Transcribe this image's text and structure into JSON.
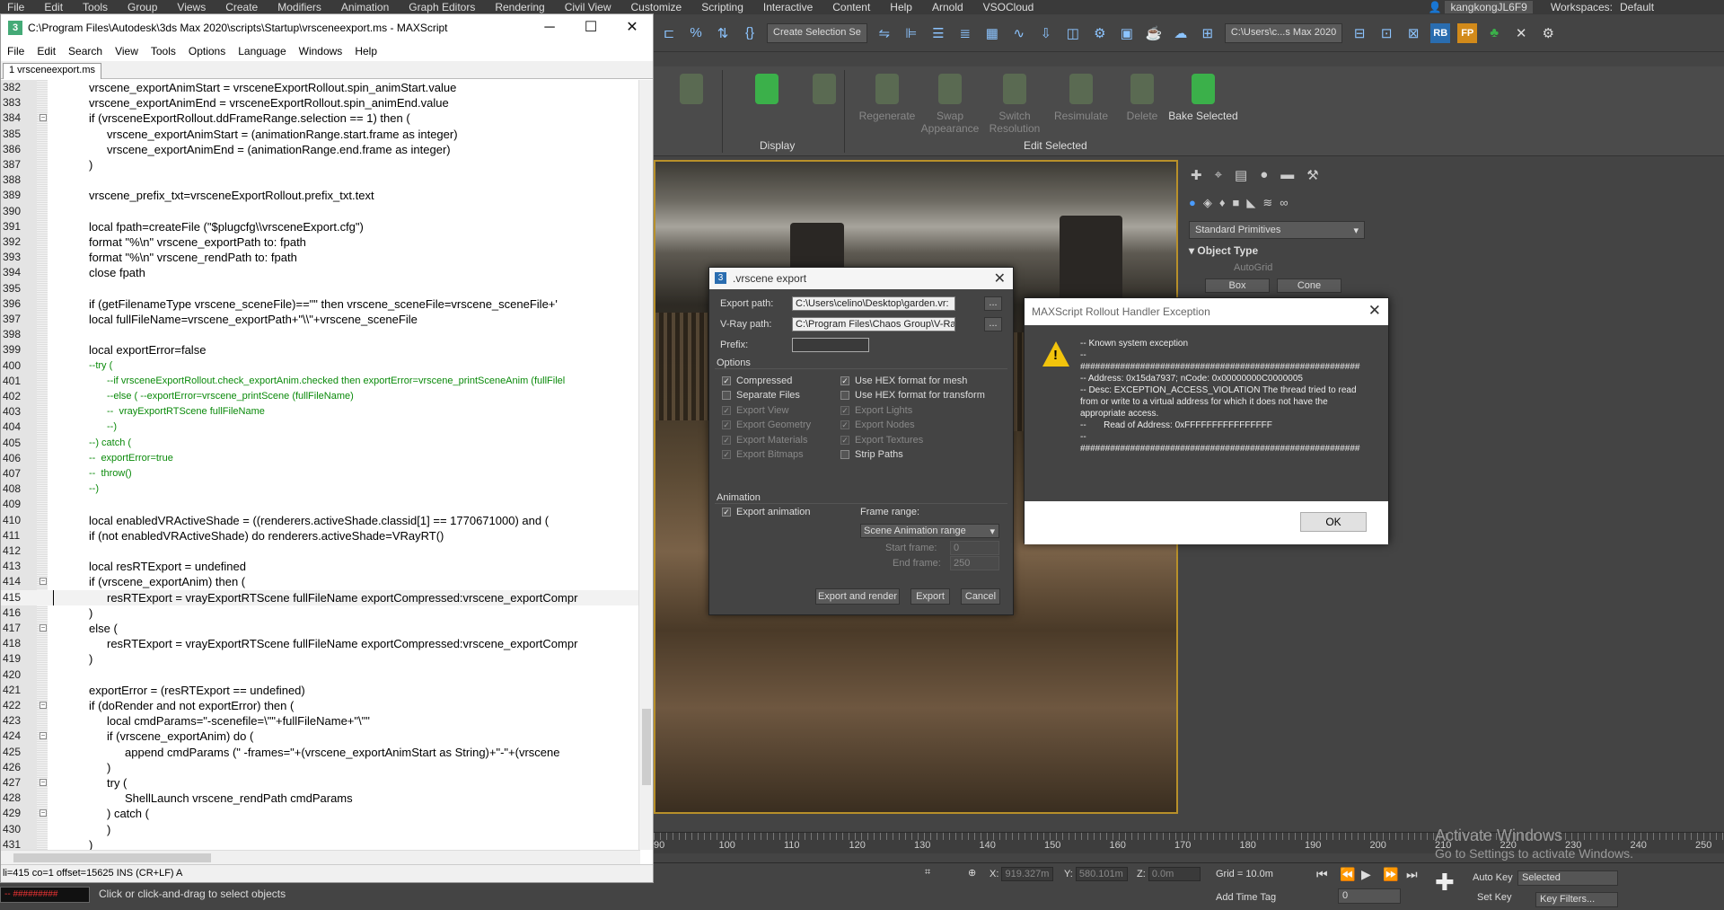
{
  "max": {
    "menu": [
      "File",
      "Edit",
      "Tools",
      "Group",
      "Views",
      "Create",
      "Modifiers",
      "Animation",
      "Graph Editors",
      "Rendering",
      "Civil View",
      "Customize",
      "Scripting",
      "Interactive",
      "Content",
      "Help",
      "Arnold",
      "VSOCloud"
    ],
    "user": "kangkongJL6F9",
    "workspaces_label": "Workspaces:",
    "workspace_value": "Default",
    "selection_set": "Create Selection Se",
    "project_path": "C:\\Users\\c...s Max 2020",
    "ribbon": {
      "regenerate": "Regenerate",
      "swap_appearance": "Swap Appearance",
      "switch_resolution": "Switch Resolution",
      "resimulate": "Resimulate",
      "delete": "Delete",
      "bake_selected": "Bake Selected",
      "group_display": "Display",
      "group_edit_selected": "Edit Selected"
    },
    "command_panel": {
      "category": "Standard Primitives",
      "rollout_title": "Object Type",
      "autogrid": "AutoGrid",
      "buttons": [
        "Box",
        "Cone"
      ]
    },
    "timeline_numbers": [
      "90",
      "100",
      "110",
      "120",
      "130",
      "140",
      "150",
      "160",
      "170",
      "180",
      "190",
      "200",
      "210",
      "220",
      "230",
      "240",
      "250"
    ],
    "activate_windows": {
      "title": "Activate Windows",
      "subtitle": "Go to Settings to activate Windows."
    },
    "status": {
      "maxscript_listener": "-- #########",
      "prompt": "Click or click-and-drag to select objects",
      "x_label": "X:",
      "x_value": "919.327m",
      "y_label": "Y:",
      "y_value": "580.101m",
      "z_label": "Z:",
      "z_value": "0.0m",
      "grid": "Grid = 10.0m",
      "add_time_tag": "Add Time Tag",
      "auto_key": "Auto Key",
      "set_key": "Set Key",
      "selected": "Selected",
      "frame": "0",
      "key_filters": "Key Filters..."
    }
  },
  "editor": {
    "title": "C:\\Program Files\\Autodesk\\3ds Max 2020\\scripts\\Startup\\vrsceneexport.ms - MAXScript",
    "menu": [
      "File",
      "Edit",
      "Search",
      "View",
      "Tools",
      "Options",
      "Language",
      "Windows",
      "Help"
    ],
    "tab": "1 vrsceneexport.ms",
    "status_line": "li=415 co=1 offset=15625 INS (CR+LF) A",
    "lines": [
      {
        "n": "382",
        "t": "vrscene_exportAnimStart = vrsceneExportRollout.spin_animStart.value",
        "i": 0
      },
      {
        "n": "383",
        "t": "vrscene_exportAnimEnd = vrsceneExportRollout.spin_animEnd.value",
        "i": 0
      },
      {
        "n": "384",
        "t": "if (vrsceneExportRollout.ddFrameRange.selection == 1) then (",
        "i": 0,
        "f": true
      },
      {
        "n": "385",
        "t": "vrscene_exportAnimStart = (animationRange.start.frame as integer)",
        "i": 1
      },
      {
        "n": "386",
        "t": "vrscene_exportAnimEnd = (animationRange.end.frame as integer)",
        "i": 1
      },
      {
        "n": "387",
        "t": ")",
        "i": 0
      },
      {
        "n": "388",
        "t": "",
        "i": 0
      },
      {
        "n": "389",
        "t": "vrscene_prefix_txt=vrsceneExportRollout.prefix_txt.text",
        "i": 0
      },
      {
        "n": "390",
        "t": "",
        "i": 0
      },
      {
        "n": "391",
        "t": "local fpath=createFile (\"$plugcfg\\\\vrsceneExport.cfg\")",
        "i": 0
      },
      {
        "n": "392",
        "t": "format \"%\\n\" vrscene_exportPath to: fpath",
        "i": 0
      },
      {
        "n": "393",
        "t": "format \"%\\n\" vrscene_rendPath to: fpath",
        "i": 0
      },
      {
        "n": "394",
        "t": "close fpath",
        "i": 0
      },
      {
        "n": "395",
        "t": "",
        "i": 0
      },
      {
        "n": "396",
        "t": "if (getFilenameType vrscene_sceneFile)==\"\" then vrscene_sceneFile=vrscene_sceneFile+'",
        "i": 0
      },
      {
        "n": "397",
        "t": "local fullFileName=vrscene_exportPath+\"\\\\\"+vrscene_sceneFile",
        "i": 0
      },
      {
        "n": "398",
        "t": "",
        "i": 0
      },
      {
        "n": "399",
        "t": "local exportError=false",
        "i": 0
      },
      {
        "n": "400",
        "t": "--try (",
        "i": 0,
        "c": true
      },
      {
        "n": "401",
        "t": "--if vrsceneExportRollout.check_exportAnim.checked then exportError=vrscene_printSceneAnim (fullFilel",
        "i": 1,
        "c": true
      },
      {
        "n": "402",
        "t": "--else ( --exportError=vrscene_printScene (fullFileName)",
        "i": 1,
        "c": true
      },
      {
        "n": "403",
        "t": "--  vrayExportRTScene fullFileName",
        "i": 1,
        "c": true
      },
      {
        "n": "404",
        "t": "--)",
        "i": 1,
        "c": true
      },
      {
        "n": "405",
        "t": "--) catch (",
        "i": 0,
        "c": true
      },
      {
        "n": "406",
        "t": "--  exportError=true",
        "i": 0,
        "c": true
      },
      {
        "n": "407",
        "t": "--  throw()",
        "i": 0,
        "c": true
      },
      {
        "n": "408",
        "t": "--)",
        "i": 0,
        "c": true
      },
      {
        "n": "409",
        "t": "",
        "i": 0
      },
      {
        "n": "410",
        "t": "local enabledVRActiveShade = ((renderers.activeShade.classid[1] == 1770671000) and (",
        "i": 0
      },
      {
        "n": "411",
        "t": "if (not enabledVRActiveShade) do renderers.activeShade=VRayRT()",
        "i": 0
      },
      {
        "n": "412",
        "t": "",
        "i": 0
      },
      {
        "n": "413",
        "t": "local resRTExport = undefined",
        "i": 0
      },
      {
        "n": "414",
        "t": "if (vrscene_exportAnim) then (",
        "i": 0,
        "f": true
      },
      {
        "n": "415",
        "t": "resRTExport = vrayExportRTScene fullFileName exportCompressed:vrscene_exportCompr",
        "i": 1,
        "cur": true
      },
      {
        "n": "416",
        "t": ")",
        "i": 0
      },
      {
        "n": "417",
        "t": "else (",
        "i": 0,
        "f": true
      },
      {
        "n": "418",
        "t": "resRTExport = vrayExportRTScene fullFileName exportCompressed:vrscene_exportCompr",
        "i": 1
      },
      {
        "n": "419",
        "t": ")",
        "i": 0
      },
      {
        "n": "420",
        "t": "",
        "i": 0
      },
      {
        "n": "421",
        "t": "exportError = (resRTExport == undefined)",
        "i": 0
      },
      {
        "n": "422",
        "t": "if (doRender and not exportError) then (",
        "i": 0,
        "f": true
      },
      {
        "n": "423",
        "t": "local cmdParams=\"-scenefile=\\\"\"+fullFileName+\"\\\"\"",
        "i": 1
      },
      {
        "n": "424",
        "t": "if (vrscene_exportAnim) do (",
        "i": 1,
        "f": true
      },
      {
        "n": "425",
        "t": "append cmdParams (\" -frames=\"+(vrscene_exportAnimStart as String)+\"-\"+(vrscene",
        "i": 2
      },
      {
        "n": "426",
        "t": ")",
        "i": 1
      },
      {
        "n": "427",
        "t": "try (",
        "i": 1,
        "f": true
      },
      {
        "n": "428",
        "t": "ShellLaunch vrscene_rendPath cmdParams",
        "i": 2
      },
      {
        "n": "429",
        "t": ") catch (",
        "i": 1,
        "f": true
      },
      {
        "n": "430",
        "t": ")",
        "i": 1
      },
      {
        "n": "431",
        "t": ")",
        "i": 0
      }
    ]
  },
  "vrscene_dialog": {
    "title": ".vrscene export",
    "export_path_label": "Export path:",
    "export_path_value": "C:\\Users\\celino\\Desktop\\garden.vr:",
    "vray_path_label": "V-Ray path:",
    "vray_path_value": "C:\\Program Files\\Chaos Group\\V-Ra",
    "browse": "...",
    "prefix_label": "Prefix:",
    "prefix_value": "",
    "options_label": "Options",
    "options_left": [
      {
        "label": "Compressed",
        "checked": true,
        "disabled": false
      },
      {
        "label": "Separate Files",
        "checked": false,
        "disabled": false
      },
      {
        "label": "Export View",
        "checked": true,
        "disabled": true
      },
      {
        "label": "Export Geometry",
        "checked": true,
        "disabled": true
      },
      {
        "label": "Export Materials",
        "checked": true,
        "disabled": true
      },
      {
        "label": "Export Bitmaps",
        "checked": true,
        "disabled": true
      }
    ],
    "options_right": [
      {
        "label": "Use HEX format for mesh",
        "checked": true,
        "disabled": false
      },
      {
        "label": "Use HEX format for transform",
        "checked": false,
        "disabled": false
      },
      {
        "label": "Export Lights",
        "checked": true,
        "disabled": true
      },
      {
        "label": "Export Nodes",
        "checked": true,
        "disabled": true
      },
      {
        "label": "Export Textures",
        "checked": true,
        "disabled": true
      },
      {
        "label": "Strip Paths",
        "checked": false,
        "disabled": false
      }
    ],
    "animation_label": "Animation",
    "export_animation": "Export animation",
    "frame_range_label": "Frame range:",
    "frame_range_value": "Scene Animation range",
    "start_frame_label": "Start frame:",
    "start_frame_value": "0",
    "end_frame_label": "End frame:",
    "end_frame_value": "250",
    "btn_export_render": "Export and render",
    "btn_export": "Export",
    "btn_cancel": "Cancel"
  },
  "exception_dialog": {
    "title": "MAXScript Rollout Handler Exception",
    "message": "-- Known system exception\n--\n########################################################\n-- Address: 0x15da7937; nCode: 0x00000000C0000005\n-- Desc: EXCEPTION_ACCESS_VIOLATION The thread tried to read from or write to a virtual address for which it does not have the appropriate access.\n--       Read of Address: 0xFFFFFFFFFFFFFFFF\n--\n########################################################",
    "ok": "OK"
  }
}
